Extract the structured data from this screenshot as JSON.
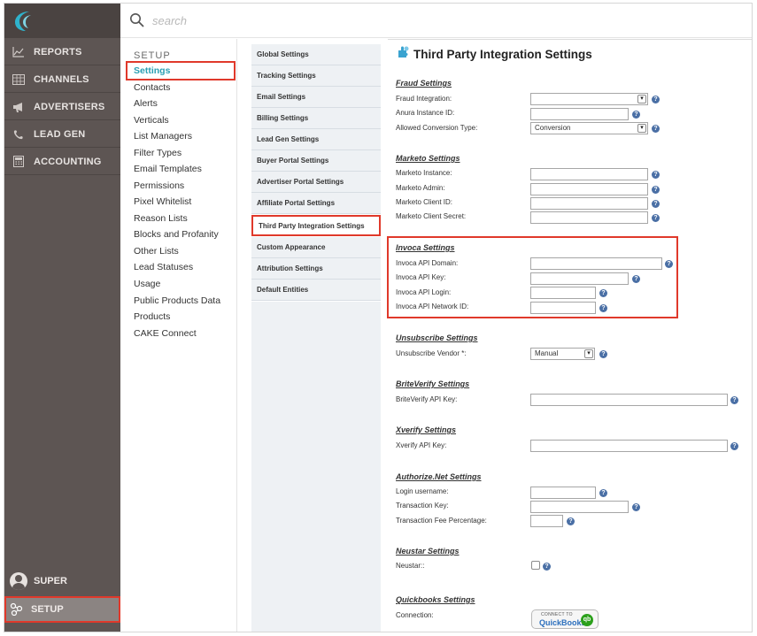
{
  "search": {
    "placeholder": "search"
  },
  "leftnav": {
    "items": [
      {
        "label": "REPORTS",
        "icon": "chart-icon"
      },
      {
        "label": "CHANNELS",
        "icon": "grid-icon"
      },
      {
        "label": "ADVERTISERS",
        "icon": "megaphone-icon"
      },
      {
        "label": "LEAD GEN",
        "icon": "phone-icon"
      },
      {
        "label": "ACCOUNTING",
        "icon": "calculator-icon"
      }
    ],
    "user_label": "SUPER",
    "setup_label": "SETUP"
  },
  "setup_menu": {
    "title": "SETUP",
    "items": [
      "Settings",
      "Contacts",
      "Alerts",
      "Verticals",
      "List Managers",
      "Filter Types",
      "Email Templates",
      "Permissions",
      "Pixel Whitelist",
      "Reason Lists",
      "Blocks and Profanity",
      "Other Lists",
      "Lead Statuses",
      "Usage",
      "Public Products Data",
      "Products",
      "CAKE Connect"
    ]
  },
  "settings_tabs": [
    "Global Settings",
    "Tracking Settings",
    "Email Settings",
    "Billing Settings",
    "Lead Gen Settings",
    "Buyer Portal Settings",
    "Advertiser Portal Settings",
    "Affiliate Portal Settings",
    "Third Party Integration Settings",
    "Custom Appearance",
    "Attribution Settings",
    "Default Entities"
  ],
  "main": {
    "title": "Third Party Integration Settings",
    "fraud": {
      "heading": "Fraud Settings",
      "fraud_integration_label": "Fraud Integration:",
      "anura_label": "Anura Instance ID:",
      "allowed_type_label": "Allowed Conversion Type:",
      "allowed_type_value": "Conversion"
    },
    "marketo": {
      "heading": "Marketo Settings",
      "instance_label": "Marketo Instance:",
      "admin_label": "Marketo Admin:",
      "client_id_label": "Marketo Client ID:",
      "client_secret_label": "Marketo Client Secret:"
    },
    "invoca": {
      "heading": "Invoca Settings",
      "domain_label": "Invoca API Domain:",
      "key_label": "Invoca API Key:",
      "login_label": "Invoca API Login:",
      "network_label": "Invoca API Network ID:"
    },
    "unsubscribe": {
      "heading": "Unsubscribe Settings",
      "vendor_label": "Unsubscribe Vendor *:",
      "vendor_value": "Manual"
    },
    "briteverify": {
      "heading": "BriteVerify Settings",
      "key_label": "BriteVerify API Key:"
    },
    "xverify": {
      "heading": "Xverify Settings",
      "key_label": "Xverify API Key:"
    },
    "authorize": {
      "heading": "Authorize.Net Settings",
      "login_label": "Login username:",
      "txn_key_label": "Transaction Key:",
      "fee_label": "Transaction Fee Percentage:"
    },
    "neustar": {
      "heading": "Neustar Settings",
      "label": "Neustar::"
    },
    "quickbooks": {
      "heading": "Quickbooks Settings",
      "connection_label": "Connection:",
      "button_top": "CONNECT TO",
      "button_main": "QuickBooks",
      "button_logo": "qb"
    },
    "help_glyph": "?"
  }
}
